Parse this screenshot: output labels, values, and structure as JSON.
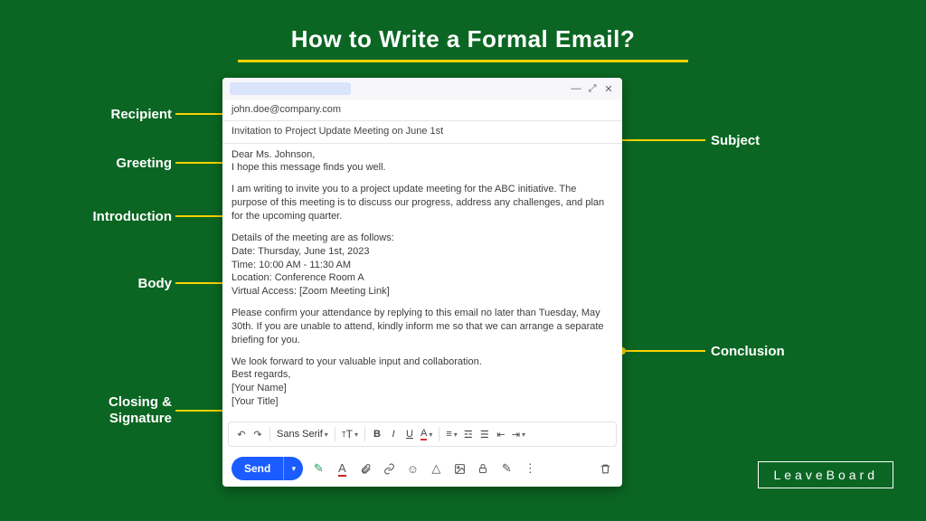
{
  "title": "How to Write a Formal Email?",
  "labels": {
    "recipient": "Recipient",
    "greeting": "Greeting",
    "introduction": "Introduction",
    "body": "Body",
    "closing": "Closing &\nSignature",
    "subject": "Subject",
    "conclusion": "Conclusion"
  },
  "email": {
    "to": "john.doe@company.com",
    "subject": "Invitation to Project Update Meeting on June 1st",
    "greeting_line1": "Dear Ms. Johnson,",
    "greeting_line2": "I hope this message finds you well.",
    "intro": "I am writing to invite you to a project update meeting for the ABC initiative. The purpose of this meeting is to discuss our progress, address any challenges, and plan for the upcoming quarter.",
    "details_heading": "Details of the meeting are as follows:",
    "detail_date": "Date: Thursday, June 1st, 2023",
    "detail_time": "Time: 10:00 AM - 11:30 AM",
    "detail_location": "Location: Conference Room A",
    "detail_virtual": "Virtual Access: [Zoom Meeting Link]",
    "conclusion": "Please confirm your attendance by replying to this email no later than Tuesday, May 30th. If you are unable to attend, kindly inform me so that we can arrange a separate briefing for you.",
    "closing_line1": "We look forward to your valuable input and collaboration.",
    "closing_line2": "Best regards,",
    "closing_line3": "[Your Name]",
    "closing_line4": "[Your Title]"
  },
  "toolbar": {
    "font": "Sans Serif",
    "send": "Send"
  },
  "brand": "LeaveBoard"
}
